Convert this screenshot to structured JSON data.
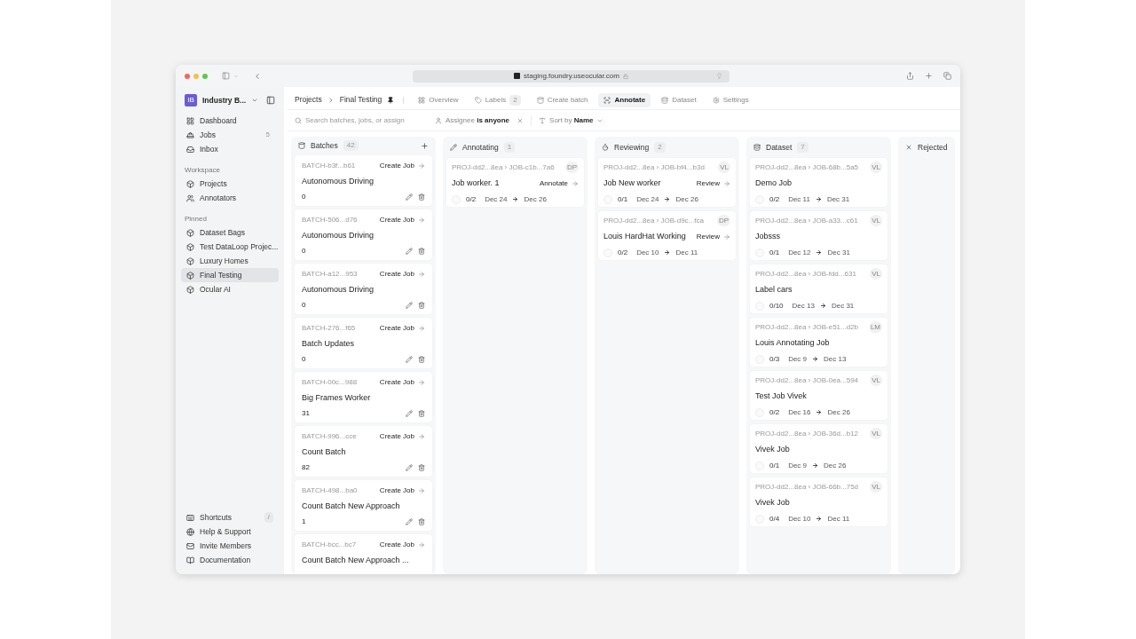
{
  "browser": {
    "url": "staging.foundry.useocular.com"
  },
  "sidebar": {
    "workspace": {
      "initials": "IB",
      "name": "Industry B..."
    },
    "main_items": [
      {
        "kind": "dashboard",
        "label": "Dashboard",
        "selected": false
      },
      {
        "kind": "jobs",
        "label": "Jobs",
        "count": "5",
        "selected": false
      },
      {
        "kind": "inbox",
        "label": "Inbox",
        "selected": false
      }
    ],
    "sections": [
      {
        "title": "Workspace",
        "items": [
          {
            "kind": "projects",
            "label": "Projects",
            "selected": false
          },
          {
            "kind": "annotators",
            "label": "Annotators",
            "selected": false
          }
        ]
      },
      {
        "title": "Pinned",
        "items": [
          {
            "kind": "project",
            "label": "Dataset Bags",
            "selected": false
          },
          {
            "kind": "project",
            "label": "Test DataLoop Projec...",
            "selected": false
          },
          {
            "kind": "project",
            "label": "Luxury Homes",
            "selected": false
          },
          {
            "kind": "project",
            "label": "Final Testing",
            "selected": true
          },
          {
            "kind": "project",
            "label": "Ocular AI",
            "selected": false
          }
        ]
      }
    ],
    "footer_items": [
      {
        "kind": "shortcuts",
        "label": "Shortcuts",
        "shortcut": "/"
      },
      {
        "kind": "help",
        "label": "Help & Support"
      },
      {
        "kind": "invite",
        "label": "Invite Members"
      },
      {
        "kind": "docs",
        "label": "Documentation"
      }
    ]
  },
  "breadcrumb": [
    "Projects",
    "Final Testing"
  ],
  "tabs": [
    {
      "kind": "overview",
      "label": "Overview",
      "selected": false
    },
    {
      "kind": "labels",
      "label": "Labels",
      "count": "2",
      "selected": false
    },
    {
      "kind": "create",
      "label": "Create batch",
      "selected": false
    },
    {
      "kind": "annotate",
      "label": "Annotate",
      "selected": true
    },
    {
      "kind": "dataset",
      "label": "Dataset",
      "selected": false
    },
    {
      "kind": "settings",
      "label": "Settings",
      "selected": false
    }
  ],
  "filters": {
    "search_placeholder": "Search batches, jobs, or assign",
    "assignee": {
      "label": "Assignee",
      "op": "is",
      "value": "anyone"
    },
    "sort": {
      "label": "Sort by",
      "value": "Name"
    }
  },
  "columns": [
    {
      "kind": "batches",
      "title": "Batches",
      "count": "42",
      "cards": [
        {
          "id": "BATCH-b3f...b61",
          "action": "Create Job",
          "title": "Autonomous Driving",
          "count": "0"
        },
        {
          "id": "BATCH-506...d76",
          "action": "Create Job",
          "title": "Autonomous Driving",
          "count": "0"
        },
        {
          "id": "BATCH-a12...953",
          "action": "Create Job",
          "title": "Autonomous Driving",
          "count": "0"
        },
        {
          "id": "BATCH-276...f65",
          "action": "Create Job",
          "title": "Batch Updates",
          "count": "0"
        },
        {
          "id": "BATCH-00c...988",
          "action": "Create Job",
          "title": "Big Frames Worker",
          "count": "31"
        },
        {
          "id": "BATCH-996...cce",
          "action": "Create Job",
          "title": "Count Batch",
          "count": "82"
        },
        {
          "id": "BATCH-498...ba0",
          "action": "Create Job",
          "title": "Count Batch New Approach",
          "count": "1"
        },
        {
          "id": "BATCH-bcc...bc7",
          "action": "Create Job",
          "title": "Count Batch New Approach ..."
        }
      ]
    },
    {
      "kind": "annotating",
      "title": "Annotating",
      "count": "1",
      "cards": [
        {
          "path": "PROJ-dd2...8ea › JOB-c1b...7a6",
          "assignee": "DP",
          "title": "Job worker. 1",
          "action": "Annotate",
          "progress": "0/2",
          "start": "Dec 24",
          "end": "Dec 26"
        }
      ]
    },
    {
      "kind": "reviewing",
      "title": "Reviewing",
      "count": "2",
      "cards": [
        {
          "path": "PROJ-dd2...8ea › JOB-bf4...b3d",
          "assignee": "VL",
          "title": "Job New worker",
          "action": "Review",
          "progress": "0/1",
          "start": "Dec 24",
          "end": "Dec 26"
        },
        {
          "path": "PROJ-dd2...8ea › JOB-d9c...fca",
          "assignee": "DP",
          "title": "Louis HardHat Working",
          "action": "Review",
          "progress": "0/2",
          "start": "Dec 10",
          "end": "Dec 11"
        }
      ]
    },
    {
      "kind": "dataset",
      "title": "Dataset",
      "count": "7",
      "cards": [
        {
          "path": "PROJ-dd2...8ea › JOB-68b...5a5",
          "assignee": "VL",
          "title": "Demo Job",
          "progress": "0/2",
          "start": "Dec 11",
          "end": "Dec 31"
        },
        {
          "path": "PROJ-dd2...8ea › JOB-a33...c61",
          "assignee": "VL",
          "title": "Jobsss",
          "progress": "0/1",
          "start": "Dec 12",
          "end": "Dec 31"
        },
        {
          "path": "PROJ-dd2...8ea › JOB-fdd...631",
          "assignee": "VL",
          "title": "Label cars",
          "progress": "0/10",
          "start": "Dec 13",
          "end": "Dec 31"
        },
        {
          "path": "PROJ-dd2...8ea › JOB-e51...d2b",
          "assignee": "LM",
          "title": "Louis Annotating Job",
          "progress": "0/3",
          "start": "Dec 9",
          "end": "Dec 13"
        },
        {
          "path": "PROJ-dd2...8ea › JOB-0ea...594",
          "assignee": "VL",
          "title": "Test Job Vivek",
          "progress": "0/2",
          "start": "Dec 16",
          "end": "Dec 26"
        },
        {
          "path": "PROJ-dd2...8ea › JOB-36d...b12",
          "assignee": "VL",
          "title": "Vivek Job",
          "progress": "0/1",
          "start": "Dec 9",
          "end": "Dec 26"
        },
        {
          "path": "PROJ-dd2...8ea › JOB-66b...75d",
          "assignee": "VL",
          "title": "Vivek Job",
          "progress": "0/4",
          "start": "Dec 10",
          "end": "Dec 11"
        }
      ]
    },
    {
      "kind": "rejected",
      "title": "Rejected"
    }
  ]
}
